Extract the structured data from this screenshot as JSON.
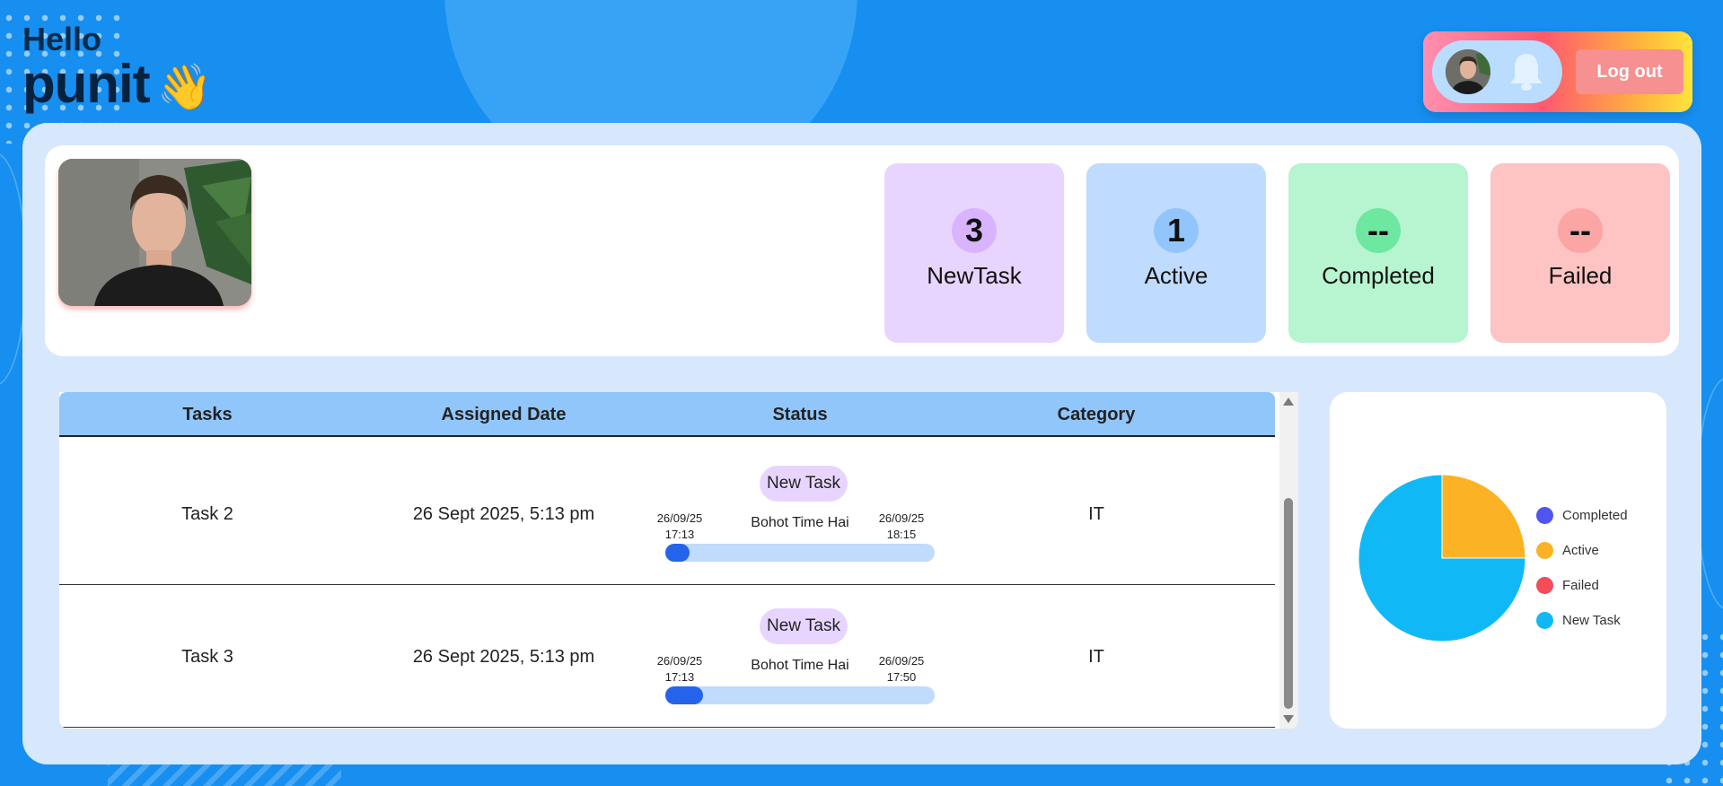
{
  "header": {
    "hello": "Hello",
    "name": "punit",
    "wave_emoji": "👋"
  },
  "topbar": {
    "logout_label": "Log out"
  },
  "stats": [
    {
      "count": "3",
      "label": "NewTask",
      "bg": "#e8d5ff",
      "badge": "#d8b4fe"
    },
    {
      "count": "1",
      "label": "Active",
      "bg": "#bfdbfe",
      "badge": "#93c5fd"
    },
    {
      "count": "--",
      "label": "Completed",
      "bg": "#b6f5cf",
      "badge": "#6ee7a0"
    },
    {
      "count": "--",
      "label": "Failed",
      "bg": "#fec3c3",
      "badge": "#fca5a5"
    }
  ],
  "table": {
    "headers": [
      "Tasks",
      "Assigned Date",
      "Status",
      "Category"
    ],
    "rows": [
      {
        "task": "Task 2",
        "assigned_date": "26 Sept 2025, 5:13 pm",
        "status": "New Task",
        "start_date": "26/09/25",
        "start_time": "17:13",
        "time_message": "Bohot Time Hai",
        "end_date": "26/09/25",
        "end_time": "18:15",
        "progress": 0.09,
        "category": "IT"
      },
      {
        "task": "Task 3",
        "assigned_date": "26 Sept 2025, 5:13 pm",
        "status": "New Task",
        "start_date": "26/09/25",
        "start_time": "17:13",
        "time_message": "Bohot Time Hai",
        "end_date": "26/09/25",
        "end_time": "17:50",
        "progress": 0.14,
        "category": "IT"
      }
    ]
  },
  "chart_data": {
    "type": "pie",
    "categories": [
      "Completed",
      "Active",
      "Failed",
      "New Task"
    ],
    "values": [
      0,
      1,
      0,
      3
    ],
    "colors": [
      "#4f55f0",
      "#fbb224",
      "#f44c58",
      "#10b9f5"
    ],
    "legend": "right"
  }
}
